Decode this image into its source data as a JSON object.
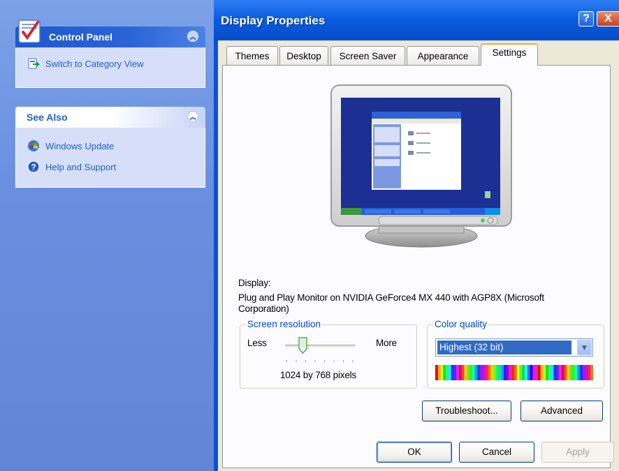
{
  "taskpane": {
    "control_panel": {
      "title": "Control Panel",
      "link": "Switch to Category View"
    },
    "see_also": {
      "title": "See Also",
      "links": [
        "Windows Update",
        "Help and Support"
      ]
    }
  },
  "window": {
    "title": "Display Properties",
    "help_glyph": "?",
    "close_glyph": "X",
    "tabs": [
      "Themes",
      "Desktop",
      "Screen Saver",
      "Appearance",
      "Settings"
    ],
    "active_tab": "Settings",
    "display_label": "Display:",
    "display_value_line1": "Plug and Play Monitor on NVIDIA GeForce4 MX 440 with AGP8X (Microsoft",
    "display_value_line2": "Corporation)",
    "resolution": {
      "legend": "Screen resolution",
      "less": "Less",
      "more": "More",
      "value": "1024 by 768 pixels",
      "slider_level": 0.25
    },
    "color_quality": {
      "legend": "Color quality",
      "selected": "Highest (32 bit)"
    },
    "buttons": {
      "troubleshoot": "Troubleshoot...",
      "advanced": "Advanced",
      "ok": "OK",
      "cancel": "Cancel",
      "apply": "Apply"
    }
  },
  "icons": {
    "control_panel": "control-panel-icon",
    "switch_view": "switch-view-icon",
    "windows_update": "windows-update-icon",
    "help": "help-icon",
    "collapse": "collapse-chevron-icon",
    "dropdown": "chevron-down-icon"
  },
  "colors": {
    "xp_blue": "#0a51d9",
    "dialog_bg": "#ece9d8",
    "link_blue": "#215dc6",
    "selection": "#316ac5",
    "group_legend": "#0046d5"
  }
}
